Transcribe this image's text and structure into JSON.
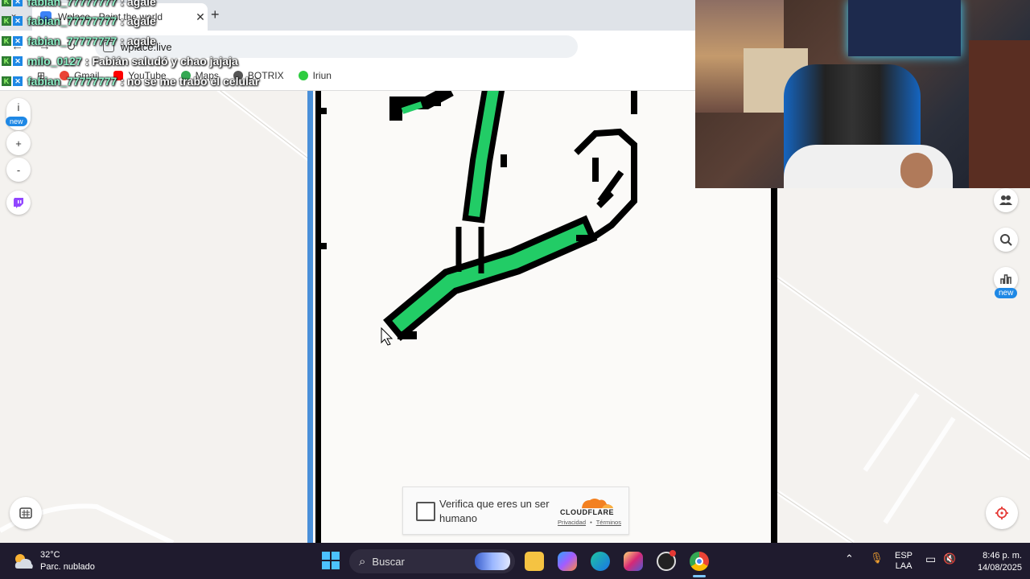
{
  "browser": {
    "tab_title": "Wplace - Paint the world",
    "url": "wplace.live",
    "bookmarks": [
      "Gmail",
      "YouTube",
      "Maps",
      "BOTRIX",
      "Iriun"
    ],
    "colors": {
      "youtube": "#ff0000",
      "botrix": "#555555",
      "iriun": "#2ecc40"
    }
  },
  "chat": [
    {
      "user": "fabian_77777777",
      "message": "agale"
    },
    {
      "user": "fabian_77777777",
      "message": "agale"
    },
    {
      "user": "fabian_77777777",
      "message": "agale"
    },
    {
      "user": "milo_0127",
      "message": "Fabián saludó y chao jajaja"
    },
    {
      "user": "fabian_77777777",
      "message": "no se me trabo el celular"
    }
  ],
  "chat_separator": ":",
  "left_rail": {
    "info_label": "i",
    "new_badge": "new",
    "zoom_in": "+",
    "zoom_out": "-"
  },
  "right_rail": {
    "new_badge": "new"
  },
  "captcha": {
    "text": "Verifica que eres un ser humano",
    "brand": "CLOUDFLARE",
    "privacy": "Privacidad",
    "terms": "Términos",
    "link_separator": "•"
  },
  "canvas": {
    "colors": {
      "green": "#22cc66",
      "black": "#000000",
      "blue_border": "#4a90d9"
    }
  },
  "taskbar": {
    "temperature": "32°C",
    "weather": "Parc. nublado",
    "search_placeholder": "Buscar",
    "language_line1": "ESP",
    "language_line2": "LAA",
    "time": "8:46 p. m.",
    "date": "14/08/2025"
  },
  "icons": [
    "info-icon",
    "plus-icon",
    "minus-icon",
    "twitch-icon",
    "people-icon",
    "search-map-icon",
    "chart-icon",
    "paint-palette-icon",
    "location-icon",
    "windows-start-icon",
    "search-icon",
    "file-explorer-icon",
    "copilot-icon",
    "edge-icon",
    "instagram-icon",
    "obs-icon",
    "chrome-icon",
    "chevron-up-icon",
    "microphone-icon",
    "display-icon",
    "volume-muted-icon"
  ]
}
